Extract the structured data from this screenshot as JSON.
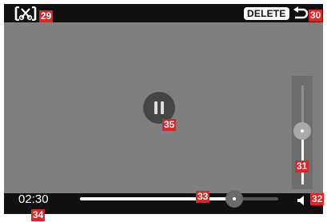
{
  "top_bar": {
    "cut_icon": "scissors-bracket-icon",
    "delete_label": "DELETE",
    "back_icon": "return-arrow-icon"
  },
  "center": {
    "pause_icon": "pause-icon"
  },
  "bottom_bar": {
    "elapsed_time": "02:30",
    "progress_fraction": 0.78,
    "speaker_icon": "speaker-icon"
  },
  "volume": {
    "level_fraction": 0.54
  },
  "callouts": {
    "cut": "29",
    "delete": "30",
    "volume": "31",
    "speaker": "32",
    "progress": "33",
    "time": "34",
    "pause": "35"
  },
  "colors": {
    "callout": "#e52222",
    "bar_background": "#101010",
    "screen": "#7f7f7f"
  }
}
